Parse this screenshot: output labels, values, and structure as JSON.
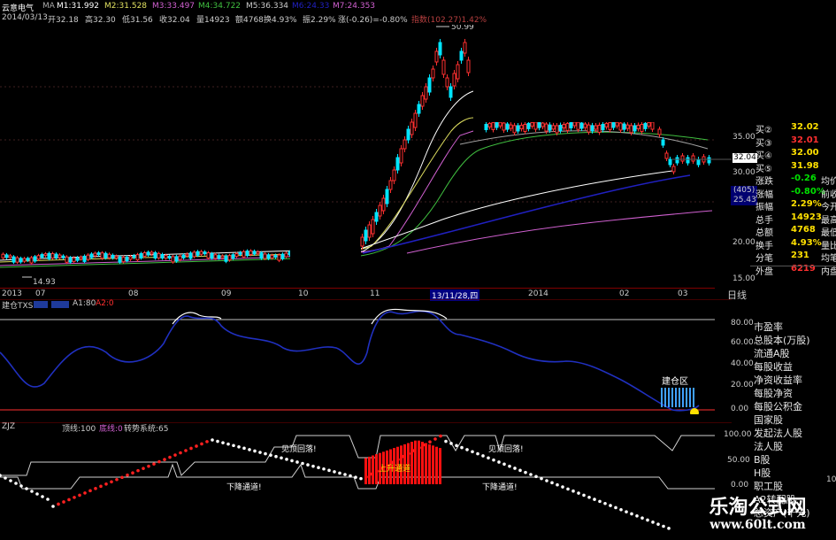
{
  "header": {
    "stock_name": "云意电气",
    "ma_label": "MA",
    "ma1": "M1:31.992",
    "ma2": "M2:31.528",
    "ma3": "M3:33.497",
    "ma4": "M4:34.722",
    "ma5": "M5:36.334",
    "ma6": "M6:24.33",
    "ma7": "M7:24.353",
    "date": "2014/03/13",
    "open": "开32.18",
    "high": "高32.30",
    "low": "低31.56",
    "close": "收32.04",
    "volume": "量14923",
    "amount": "额4768",
    "turnover": "换4.93%",
    "amplitude": "振2.29%",
    "change": "涨(-0.26)=-0.80%",
    "index": "指数(102.27)1.42%"
  },
  "main_chart": {
    "price_ticks": [
      "35.00",
      "30.00",
      "25.43",
      "20.00",
      "15.00"
    ],
    "current_price_tag": "32.04",
    "volume_tag": "(405)",
    "peak_label": "50.99",
    "low_label": "14.93",
    "time_axis": [
      "2013",
      "07",
      "08",
      "09",
      "10",
      "11",
      "13/11/28,四",
      "2014",
      "02",
      "03"
    ],
    "right_tab": "日线",
    "colors": {
      "up": "#ff3030",
      "down": "#00e5ff",
      "ma_white": "#ffffff",
      "ma_yellow": "#e0e060",
      "ma_magenta": "#d060d0",
      "ma_green": "#40c040",
      "ma_blue": "#2020c0"
    }
  },
  "indicator1": {
    "title": "建仓TXS",
    "param1": "A1:80",
    "param2": "A2:0",
    "ticks": [
      "80.00",
      "60.00",
      "40.00",
      "20.00",
      "0.00"
    ],
    "zone_label": "建仓区"
  },
  "indicator2": {
    "title": "ZJZ",
    "param1": "顶线:100",
    "param2": "底线:0",
    "param3": "转势系统:65",
    "ticks": [
      "100.00",
      "50.00",
      "0.00"
    ],
    "signal1": "见顶回落!",
    "signal2": "见顶回落!",
    "signal3": "下降通道!",
    "signal4": "下降通道!",
    "signal5": "上升通道"
  },
  "quote_panel": {
    "rows": [
      {
        "k": "买②",
        "v": "32.02",
        "color": "#ffe000"
      },
      {
        "k": "买③",
        "v": "32.01",
        "color": "#ff3030"
      },
      {
        "k": "买④",
        "v": "32.00",
        "color": "#ffe000"
      },
      {
        "k": "买⑤",
        "v": "31.98",
        "color": "#ffe000"
      },
      {
        "k": "涨跌",
        "v": "-0.26",
        "color": "#00e000",
        "extra": "均价"
      },
      {
        "k": "涨幅",
        "v": "-0.80%",
        "color": "#00e000",
        "extra": "前收"
      },
      {
        "k": "振幅",
        "v": "2.29%",
        "color": "#ffe000",
        "extra": "今开"
      },
      {
        "k": "总手",
        "v": "14923",
        "color": "#ffe000",
        "extra": "最高"
      },
      {
        "k": "总额",
        "v": "4768",
        "color": "#ffe000",
        "extra": "最低"
      },
      {
        "k": "换手",
        "v": "4.93%",
        "color": "#ffe000",
        "extra": "量比"
      },
      {
        "k": "分笔",
        "v": "231",
        "color": "#ffe000",
        "extra": "均笔"
      },
      {
        "k": "外盘",
        "v": "6219",
        "color": "#ff3030",
        "extra": "内盘"
      }
    ],
    "fin_items": [
      "市盈率",
      "总股本(万股)",
      "流通A股",
      "每股收益",
      "净资收益率",
      "每股净资",
      "每股公积金",
      "国家股",
      "发起法人股",
      "法人股",
      "B股",
      "H股",
      "职工股",
      "A2转配股",
      "总资产(千元)"
    ],
    "corner_text": "10"
  },
  "watermark": {
    "cn": "乐淘公式网",
    "url": "www.60lt.com"
  }
}
